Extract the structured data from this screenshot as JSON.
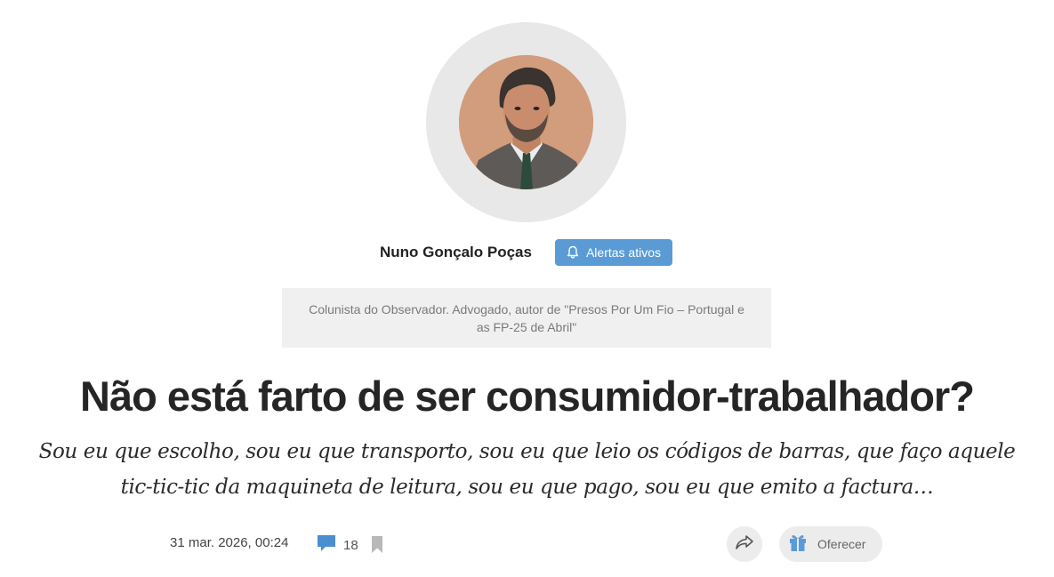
{
  "author": {
    "name": "Nuno Gonçalo Poças",
    "alerts_label": "Alertas ativos",
    "bio": "Colunista do Observador. Advogado, autor de \"Presos Por Um Fio – Portugal e as FP-25 de Abril\""
  },
  "article": {
    "title": "Não está farto de ser consumidor-trabalhador?",
    "lead": "Sou eu que escolho, sou eu que transporto, sou eu que leio os códigos de barras, que faço aquele tic-tic-tic da maquineta de leitura, sou eu que pago, sou eu que emito a factura…"
  },
  "meta": {
    "date": "31 mar. 2026, 00:24",
    "comment_count": "18"
  },
  "actions": {
    "offer_label": "Oferecer"
  },
  "icons": {
    "alerts": "bell-icon",
    "comments": "comment-bubble-icon",
    "bookmark": "bookmark-icon",
    "share": "share-arrow-icon",
    "offer": "gift-icon"
  },
  "colors": {
    "accent_blue": "#5b9bd5",
    "light_gray": "#ececec",
    "bio_background": "#f0f0f0"
  }
}
